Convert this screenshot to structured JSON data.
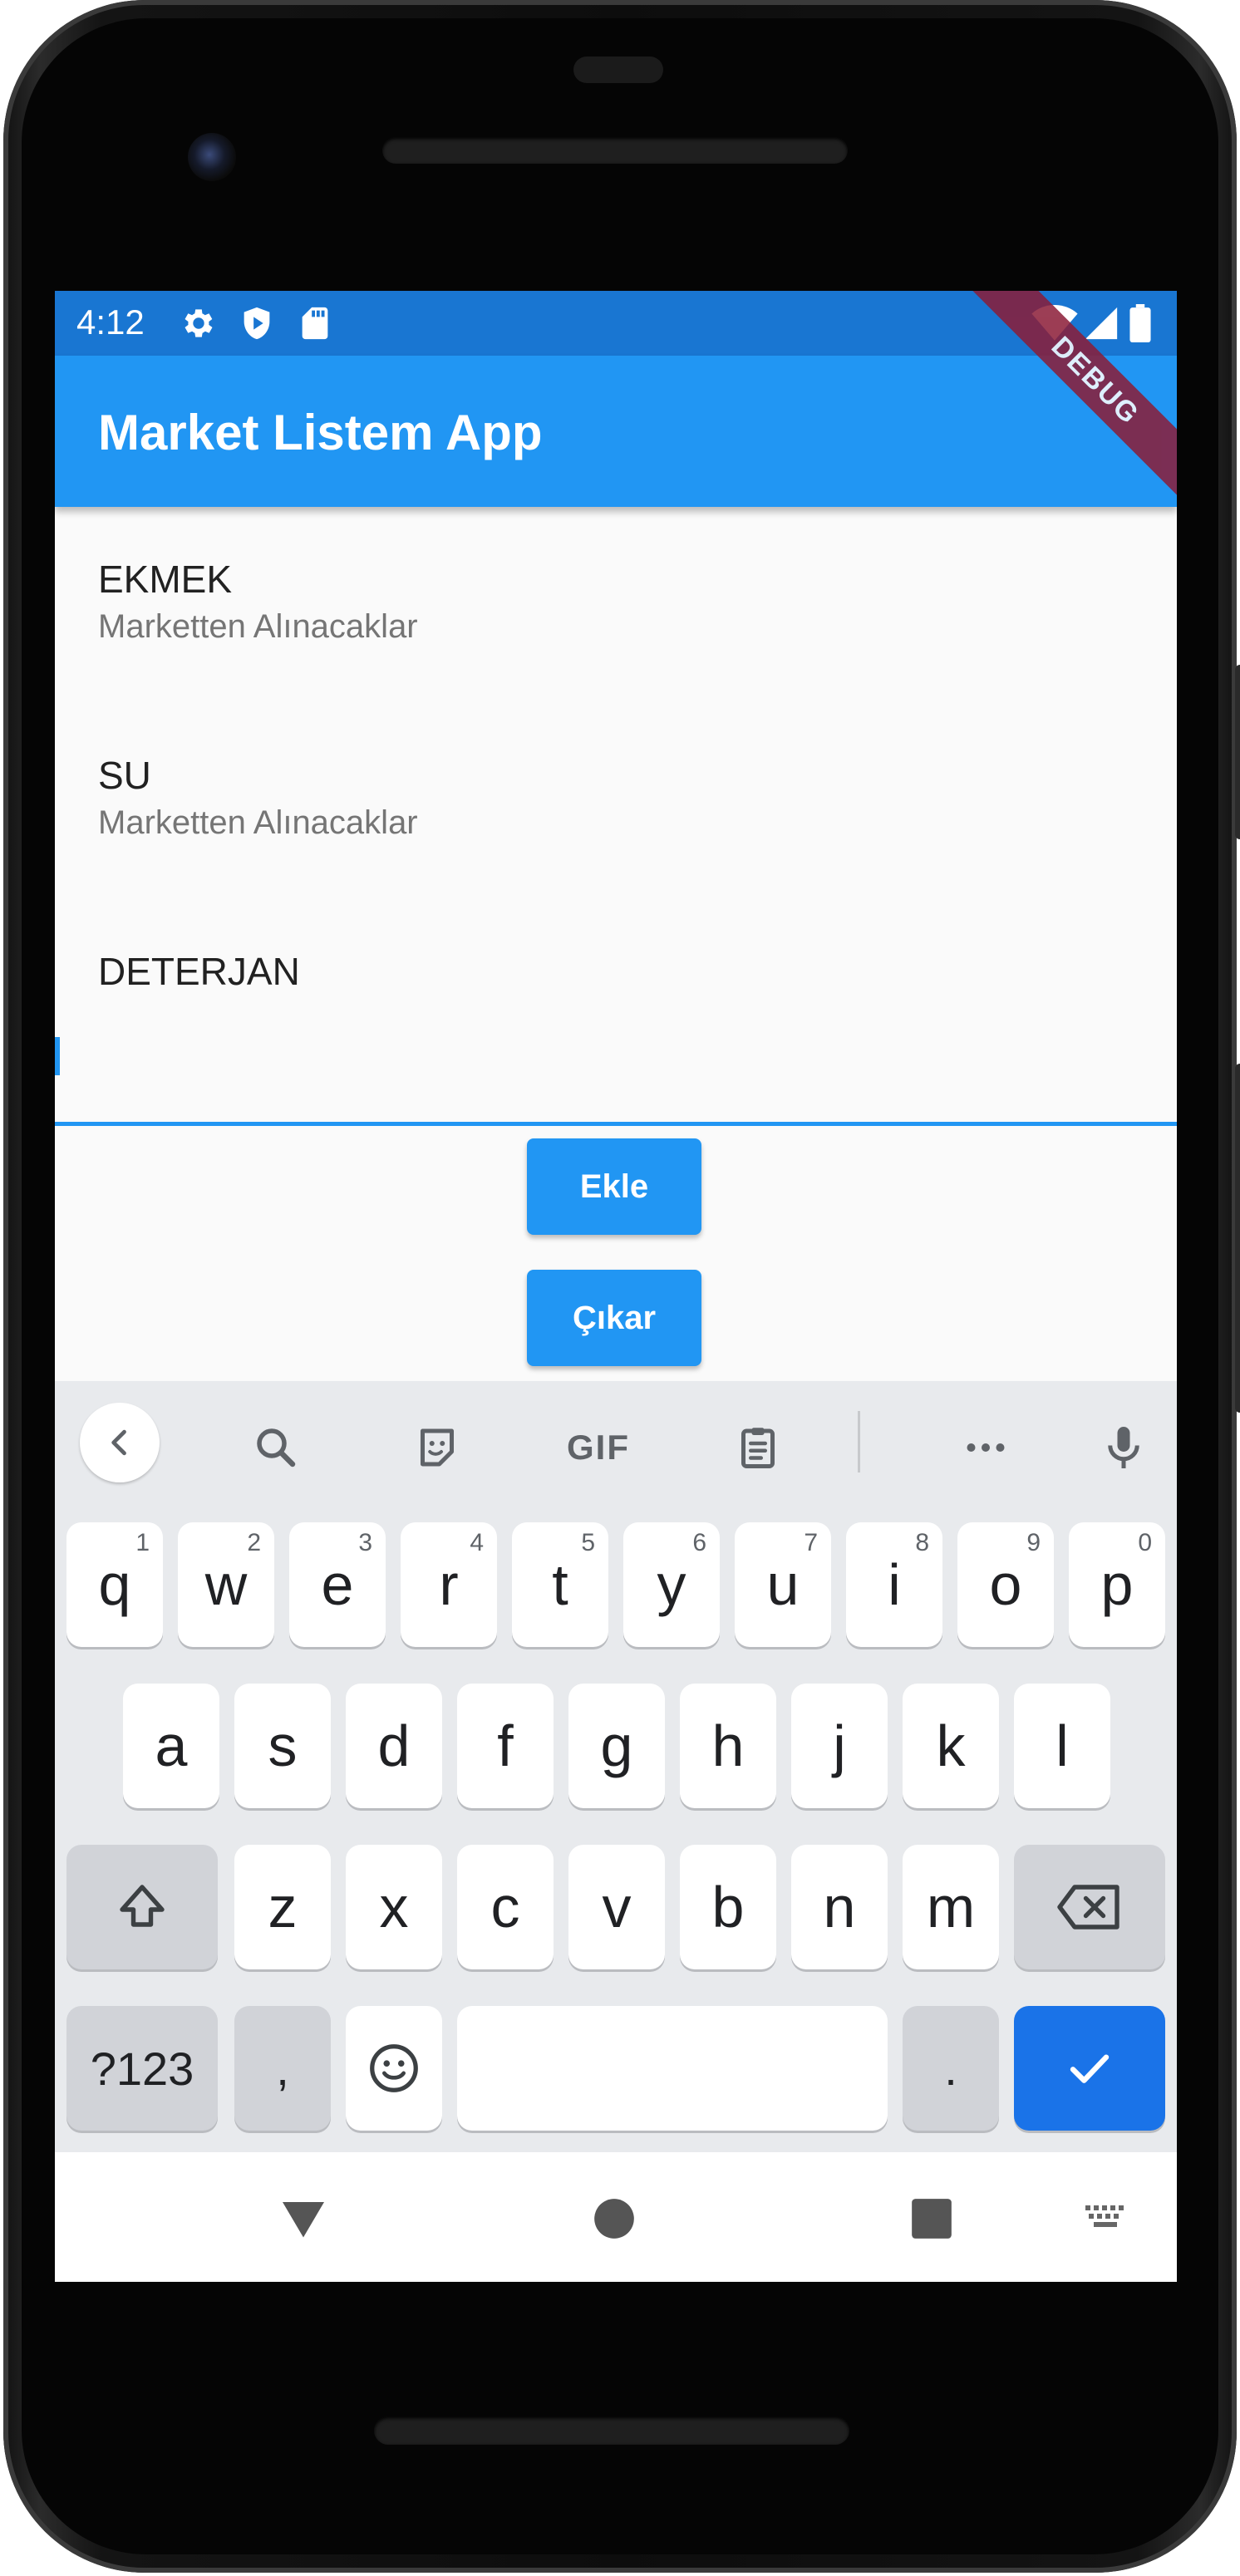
{
  "status_bar": {
    "time": "4:12",
    "icons_left": [
      "gear-icon",
      "shield-play-icon",
      "sd-card-icon"
    ],
    "icons_right": [
      "wifi-icon",
      "signal-icon",
      "battery-icon"
    ],
    "color": "#1976d2"
  },
  "debug_banner": "DEBUG",
  "app_bar": {
    "title": "Market Listem App",
    "color": "#2196f3"
  },
  "list": {
    "items": [
      {
        "title": "EKMEK",
        "subtitle": "Marketten Alınacaklar"
      },
      {
        "title": "SU",
        "subtitle": "Marketten Alınacaklar"
      },
      {
        "title": "DETERJAN"
      }
    ]
  },
  "input": {
    "value": "",
    "accent_color": "#2196f3"
  },
  "buttons": {
    "add_label": "Ekle",
    "remove_label": "Çıkar"
  },
  "keyboard": {
    "toolbar": {
      "back_icon": "chevron-left-icon",
      "search_icon": "search-icon",
      "sticker_icon": "sticker-icon",
      "gif_label": "GIF",
      "clipboard_icon": "clipboard-icon",
      "more_icon": "more-horiz-icon",
      "mic_icon": "mic-icon"
    },
    "row1": [
      {
        "k": "q",
        "s": "1"
      },
      {
        "k": "w",
        "s": "2"
      },
      {
        "k": "e",
        "s": "3"
      },
      {
        "k": "r",
        "s": "4"
      },
      {
        "k": "t",
        "s": "5"
      },
      {
        "k": "y",
        "s": "6"
      },
      {
        "k": "u",
        "s": "7"
      },
      {
        "k": "i",
        "s": "8"
      },
      {
        "k": "o",
        "s": "9"
      },
      {
        "k": "p",
        "s": "0"
      }
    ],
    "row2": [
      "a",
      "s",
      "d",
      "f",
      "g",
      "h",
      "j",
      "k",
      "l"
    ],
    "row3": [
      "z",
      "x",
      "c",
      "v",
      "b",
      "n",
      "m"
    ],
    "row4": {
      "symbols": "?123",
      "comma": ",",
      "period": ".",
      "space": ""
    },
    "enter_color": "#1a73e8"
  },
  "nav_bar": {
    "back_icon": "back-triangle-icon",
    "home_icon": "home-circle-icon",
    "recents_icon": "recents-square-icon",
    "keyboard_icon": "keyboard-switch-icon"
  }
}
